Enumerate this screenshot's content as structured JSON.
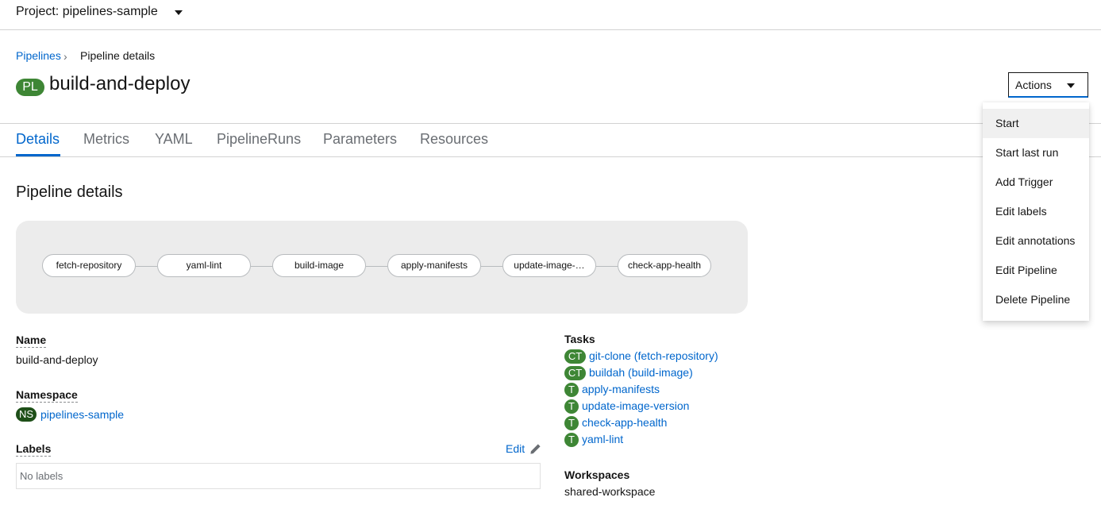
{
  "project": {
    "label": "Project: pipelines-sample"
  },
  "breadcrumb": {
    "parent": "Pipelines",
    "current": "Pipeline details"
  },
  "header": {
    "badge": "PL",
    "title": "build-and-deploy",
    "actions_label": "Actions"
  },
  "tabs": [
    "Details",
    "Metrics",
    "YAML",
    "PipelineRuns",
    "Parameters",
    "Resources"
  ],
  "section_title": "Pipeline details",
  "graph_nodes": [
    "fetch-repository",
    "yaml-lint",
    "build-image",
    "apply-manifests",
    "update-image-…",
    "check-app-health"
  ],
  "details": {
    "name_label": "Name",
    "name_value": "build-and-deploy",
    "namespace_label": "Namespace",
    "namespace_badge": "NS",
    "namespace_value": "pipelines-sample",
    "labels_label": "Labels",
    "edit_label": "Edit",
    "labels_empty": "No labels"
  },
  "tasks": {
    "title": "Tasks",
    "items": [
      {
        "badge": "CT",
        "label": "git-clone (fetch-repository)"
      },
      {
        "badge": "CT",
        "label": "buildah (build-image)"
      },
      {
        "badge": "T",
        "label": "apply-manifests"
      },
      {
        "badge": "T",
        "label": "update-image-version"
      },
      {
        "badge": "T",
        "label": "check-app-health"
      },
      {
        "badge": "T",
        "label": "yaml-lint"
      }
    ]
  },
  "workspaces": {
    "title": "Workspaces",
    "value": "shared-workspace"
  },
  "actions_menu": [
    "Start",
    "Start last run",
    "Add Trigger",
    "Edit labels",
    "Edit annotations",
    "Edit Pipeline",
    "Delete Pipeline"
  ],
  "colors": {
    "link": "#0066cc",
    "badge_green": "#3e8635",
    "badge_dark_green": "#1e4f18"
  }
}
